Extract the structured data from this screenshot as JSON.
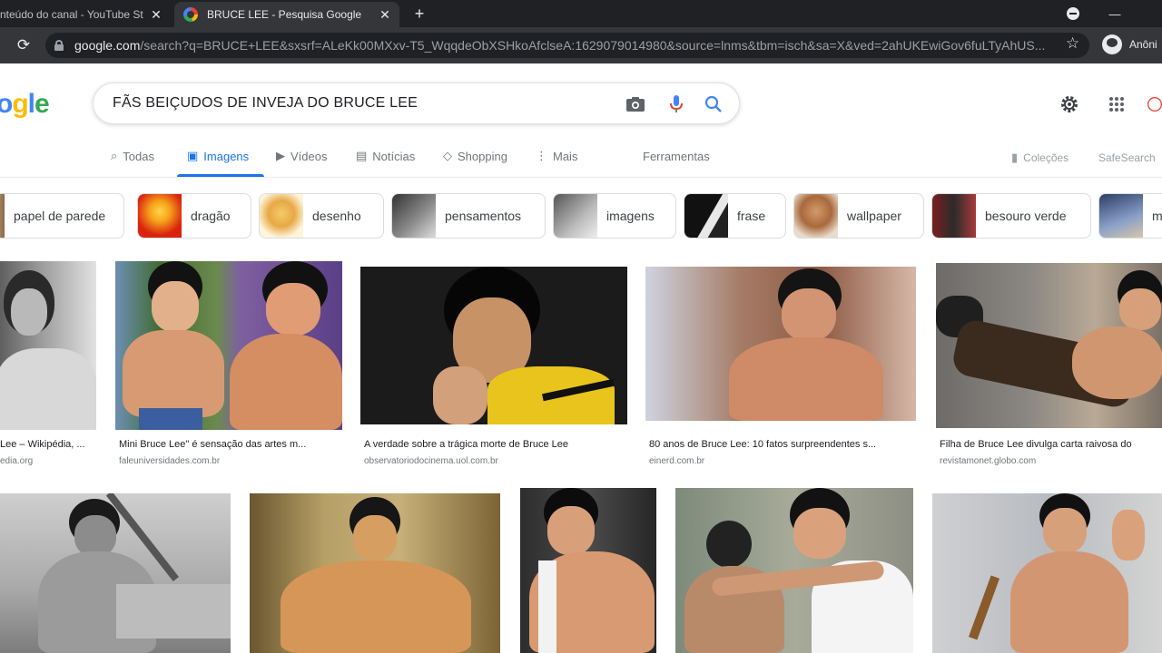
{
  "browser": {
    "tabs": [
      {
        "title": "nteúdo do canal - YouTube St",
        "active": false
      },
      {
        "title": "BRUCE LEE - Pesquisa Google",
        "active": true
      }
    ],
    "new_tab": "+",
    "url_host": "google.com",
    "url_rest": "/search?q=BRUCE+LEE&sxsrf=ALeKk00MXxv-T5_WqqdeObXSHkoAfclseA:1629079014980&source=lnms&tbm=isch&sa=X&ved=2ahUKEwiGov6fuLTyAhUS...",
    "profile_name": "Anôni"
  },
  "search": {
    "logo": "ogle",
    "query": "FÃS BEIÇUDOS DE INVEJA DO BRUCE LEE"
  },
  "nav": {
    "tabs": [
      {
        "label": "Todas",
        "icon": "search-icon"
      },
      {
        "label": "Imagens",
        "icon": "image-icon",
        "active": true
      },
      {
        "label": "Vídeos",
        "icon": "video-icon"
      },
      {
        "label": "Notícias",
        "icon": "news-icon"
      },
      {
        "label": "Shopping",
        "icon": "tag-icon"
      },
      {
        "label": "Mais",
        "icon": "more-vert-icon"
      }
    ],
    "tools": "Ferramentas",
    "collections": "Coleções",
    "safesearch": "SafeSearch"
  },
  "chips": [
    {
      "label": "papel de parede"
    },
    {
      "label": "dragão"
    },
    {
      "label": "desenho"
    },
    {
      "label": "pensamentos"
    },
    {
      "label": "imagens"
    },
    {
      "label": "frase"
    },
    {
      "label": "wallpaper"
    },
    {
      "label": "besouro verde"
    },
    {
      "label": "m"
    }
  ],
  "results": [
    {
      "caption": "Lee – Wikipédia, ...",
      "source": "edia.org"
    },
    {
      "caption": "Mini Bruce Lee\" é sensação das artes m...",
      "source": "faleuniversidades.com.br"
    },
    {
      "caption": "A verdade sobre a trágica morte de Bruce Lee",
      "source": "observatoriodocinema.uol.com.br"
    },
    {
      "caption": "80 anos de Bruce Lee: 10 fatos surpreendentes s...",
      "source": "einerd.com.br"
    },
    {
      "caption": "Filha de Bruce Lee divulga carta raivosa do",
      "source": "revistamonet.globo.com"
    }
  ],
  "colors": {
    "accent": "#1a73e8",
    "chrome_dark": "#202124",
    "chrome_toolbar": "#35363a"
  }
}
